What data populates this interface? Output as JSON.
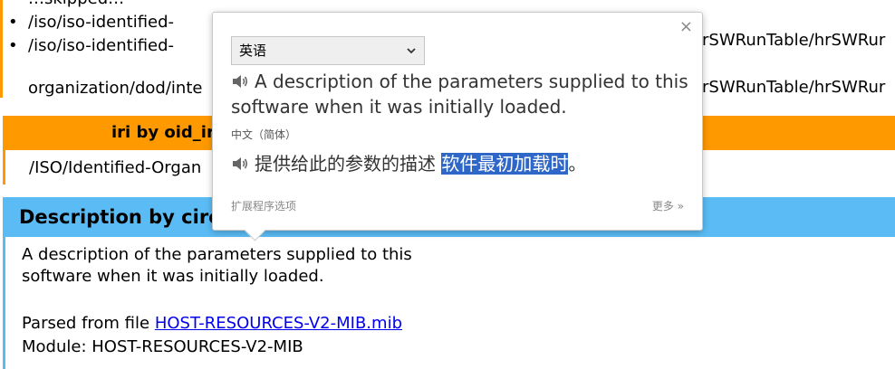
{
  "top": {
    "items": [
      {
        "bullet": "•",
        "text": "…skipped…"
      },
      {
        "bullet": "•",
        "text": "/iso/iso-identified-"
      },
      {
        "bullet": "•",
        "text": "/iso/iso-identified-"
      }
    ],
    "continuation": "organization/dod/inte",
    "right_fragment_1": "rSWRunTable/hrSWRur",
    "right_fragment_2": "rSWRunTable/hrSWRur"
  },
  "iri": {
    "header": "iri by oid_ir",
    "value": "/ISO/Identified-Organ"
  },
  "description": {
    "header": "Description by circ",
    "line1": "A description of the parameters supplied to this",
    "line2": "software when it was initially loaded.",
    "parsed_prefix": "Parsed from file ",
    "parsed_link": "HOST-RESOURCES-V2-MIB.mib",
    "module": "Module: HOST-RESOURCES-V2-MIB"
  },
  "popup": {
    "close": "×",
    "source_language": "英语",
    "source_text": "A description of the parameters supplied to this software when it was initially loaded.",
    "target_language": "中文（简体）",
    "target_text_plain": "提供给此的参数的描述 ",
    "target_text_highlight": "软件最初加载时",
    "target_text_end": "。",
    "extension_options": "扩展程序选项",
    "more": "更多 »"
  },
  "icons": {
    "speaker": "speaker-icon",
    "chevron": "chevron-down-icon",
    "close": "close-icon"
  },
  "colors": {
    "orange": "#ff9900",
    "blue": "#5bbcf5",
    "highlight": "#2f67c9",
    "link": "#0000ee"
  }
}
